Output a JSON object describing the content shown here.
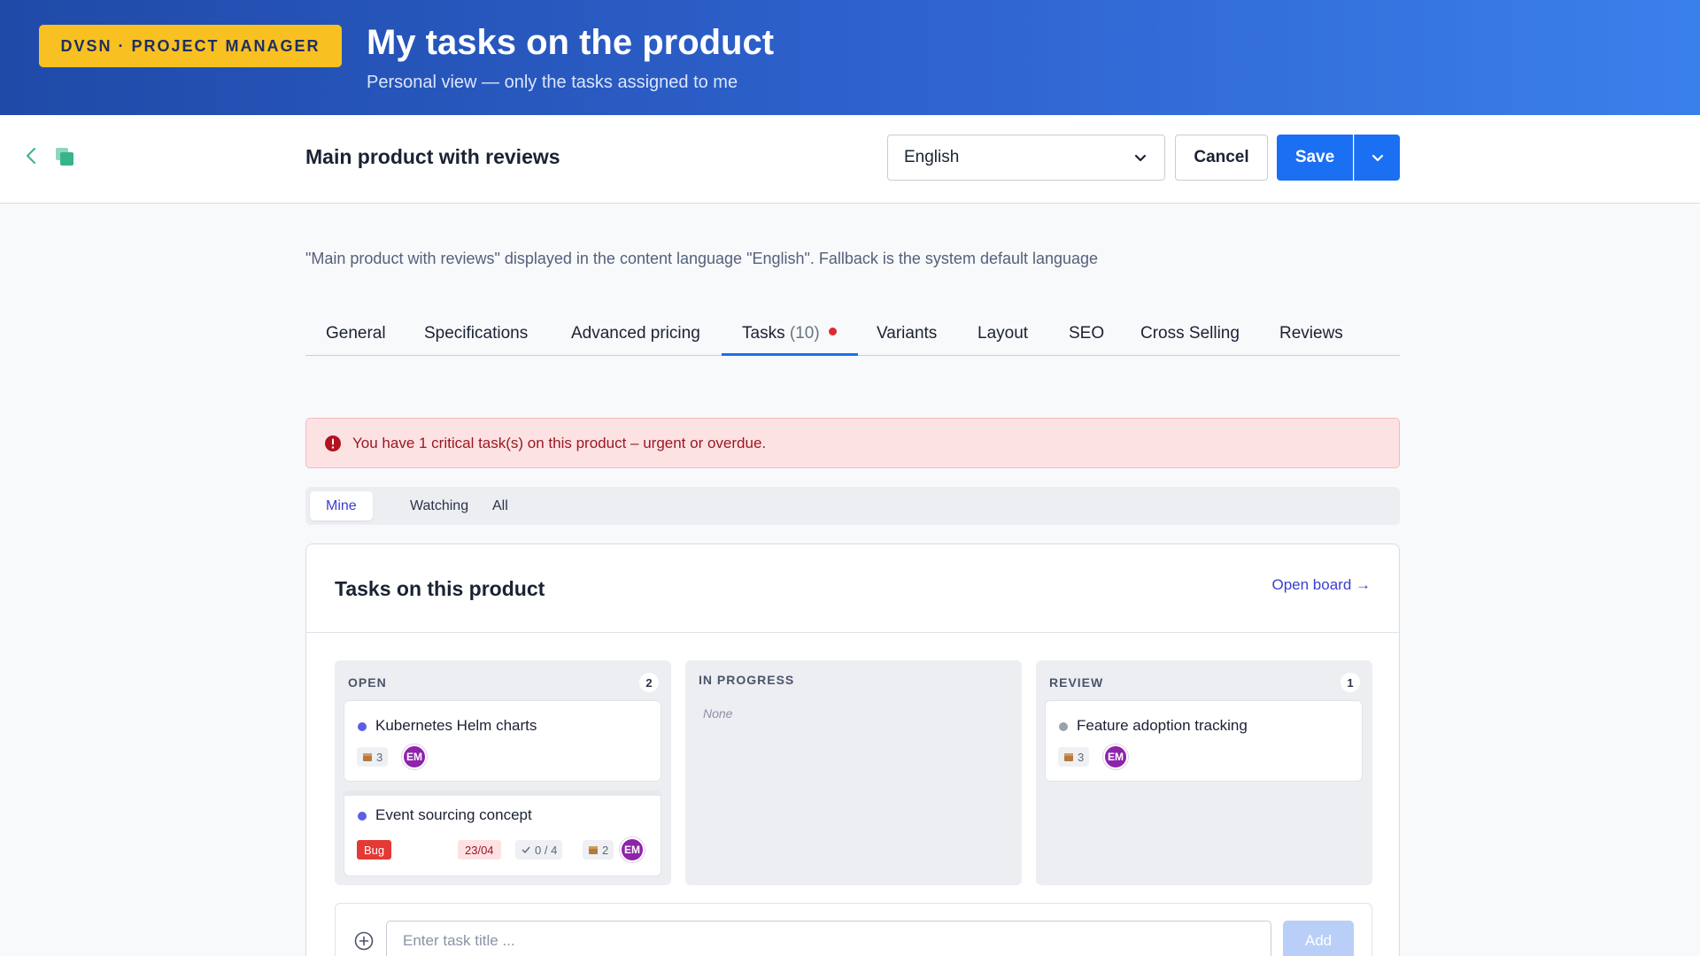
{
  "banner": {
    "badge": "DVSN · PROJECT MANAGER",
    "title": "My tasks on the product",
    "subtitle": "Personal view — only the tasks assigned to me"
  },
  "topbar": {
    "product_title": "Main product with reviews",
    "language": "English",
    "cancel_label": "Cancel",
    "save_label": "Save"
  },
  "language_note": "\"Main product with reviews\" displayed in the content language \"English\". Fallback is the system default language",
  "tabs": [
    {
      "label": "General"
    },
    {
      "label": "Specifications"
    },
    {
      "label": "Advanced pricing"
    },
    {
      "label": "Tasks",
      "count": "(10)",
      "active": true
    },
    {
      "label": "Variants"
    },
    {
      "label": "Layout"
    },
    {
      "label": "SEO"
    },
    {
      "label": "Cross Selling"
    },
    {
      "label": "Reviews"
    }
  ],
  "alert": {
    "text": "You have 1 critical task(s) on this product – urgent or overdue.",
    "color": "#9a1821"
  },
  "filter": {
    "options": [
      "Mine",
      "Watching",
      "All"
    ],
    "selected": "Mine"
  },
  "card": {
    "title": "Tasks on this product",
    "open_board": "Open board →"
  },
  "columns": [
    {
      "title": "OPEN",
      "count": "2",
      "tasks": [
        {
          "title": "Kubernetes Helm charts",
          "dot_color": "#5b5ee6",
          "products": "3",
          "assignee": "EM"
        },
        {
          "title": "Event sourcing concept",
          "dot_color": "#5b5ee6",
          "tag": "Bug",
          "due": "23/04",
          "checklist": "0 / 4",
          "products": "2",
          "assignee": "EM"
        }
      ]
    },
    {
      "title": "IN PROGRESS",
      "empty": "None"
    },
    {
      "title": "REVIEW",
      "count": "1",
      "tasks": [
        {
          "title": "Feature adoption tracking",
          "dot_color": "#9aa1ad",
          "products": "3",
          "assignee": "EM"
        }
      ]
    }
  ],
  "new_task": {
    "placeholder": "Enter task title ...",
    "add_label": "Add"
  },
  "colors": {
    "primary": "#1b6ff2",
    "accent": "#3a3fd0",
    "badge": "#f9c022",
    "avatar": "#8e24aa",
    "bug": "#e53935"
  }
}
